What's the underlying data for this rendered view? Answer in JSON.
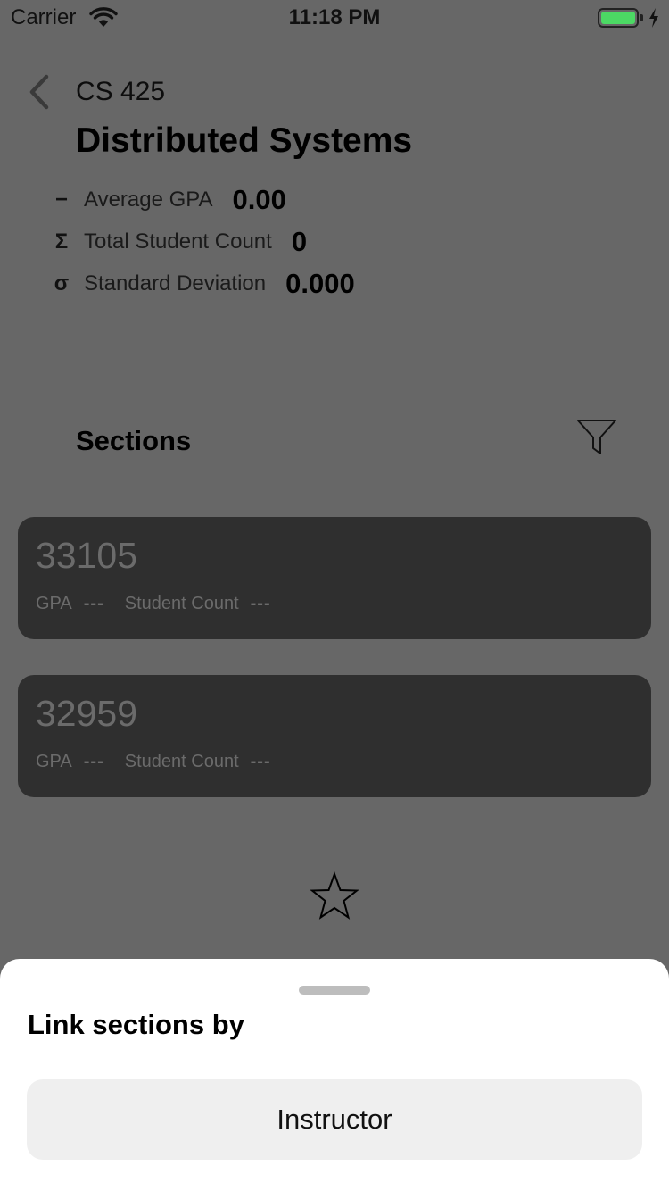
{
  "status_bar": {
    "carrier": "Carrier",
    "time": "11:18 PM",
    "battery_level": 1.0,
    "battery_color": "#4cd964",
    "charging": true
  },
  "header": {
    "back_icon": "chevron-left-icon",
    "course_code": "CS 425",
    "course_title": "Distributed Systems"
  },
  "stats": [
    {
      "icon": "−",
      "icon_name": "minus-icon",
      "label": "Average GPA",
      "value": "0.00"
    },
    {
      "icon": "Σ",
      "icon_name": "sigma-icon",
      "label": "Total Student Count",
      "value": "0"
    },
    {
      "icon": "σ",
      "icon_name": "sigma-lowercase-icon",
      "label": "Standard Deviation",
      "value": "0.000"
    }
  ],
  "sections": {
    "heading": "Sections",
    "filter_icon": "filter-icon",
    "cards": [
      {
        "number": "33105",
        "gpa_label": "GPA",
        "gpa_value": "---",
        "count_label": "Student Count",
        "count_value": "---"
      },
      {
        "number": "32959",
        "gpa_label": "GPA",
        "gpa_value": "---",
        "count_label": "Student Count",
        "count_value": "---"
      }
    ]
  },
  "favorite_icon": "star-outline-icon",
  "sheet": {
    "title": "Link sections by",
    "option_label": "Instructor"
  }
}
